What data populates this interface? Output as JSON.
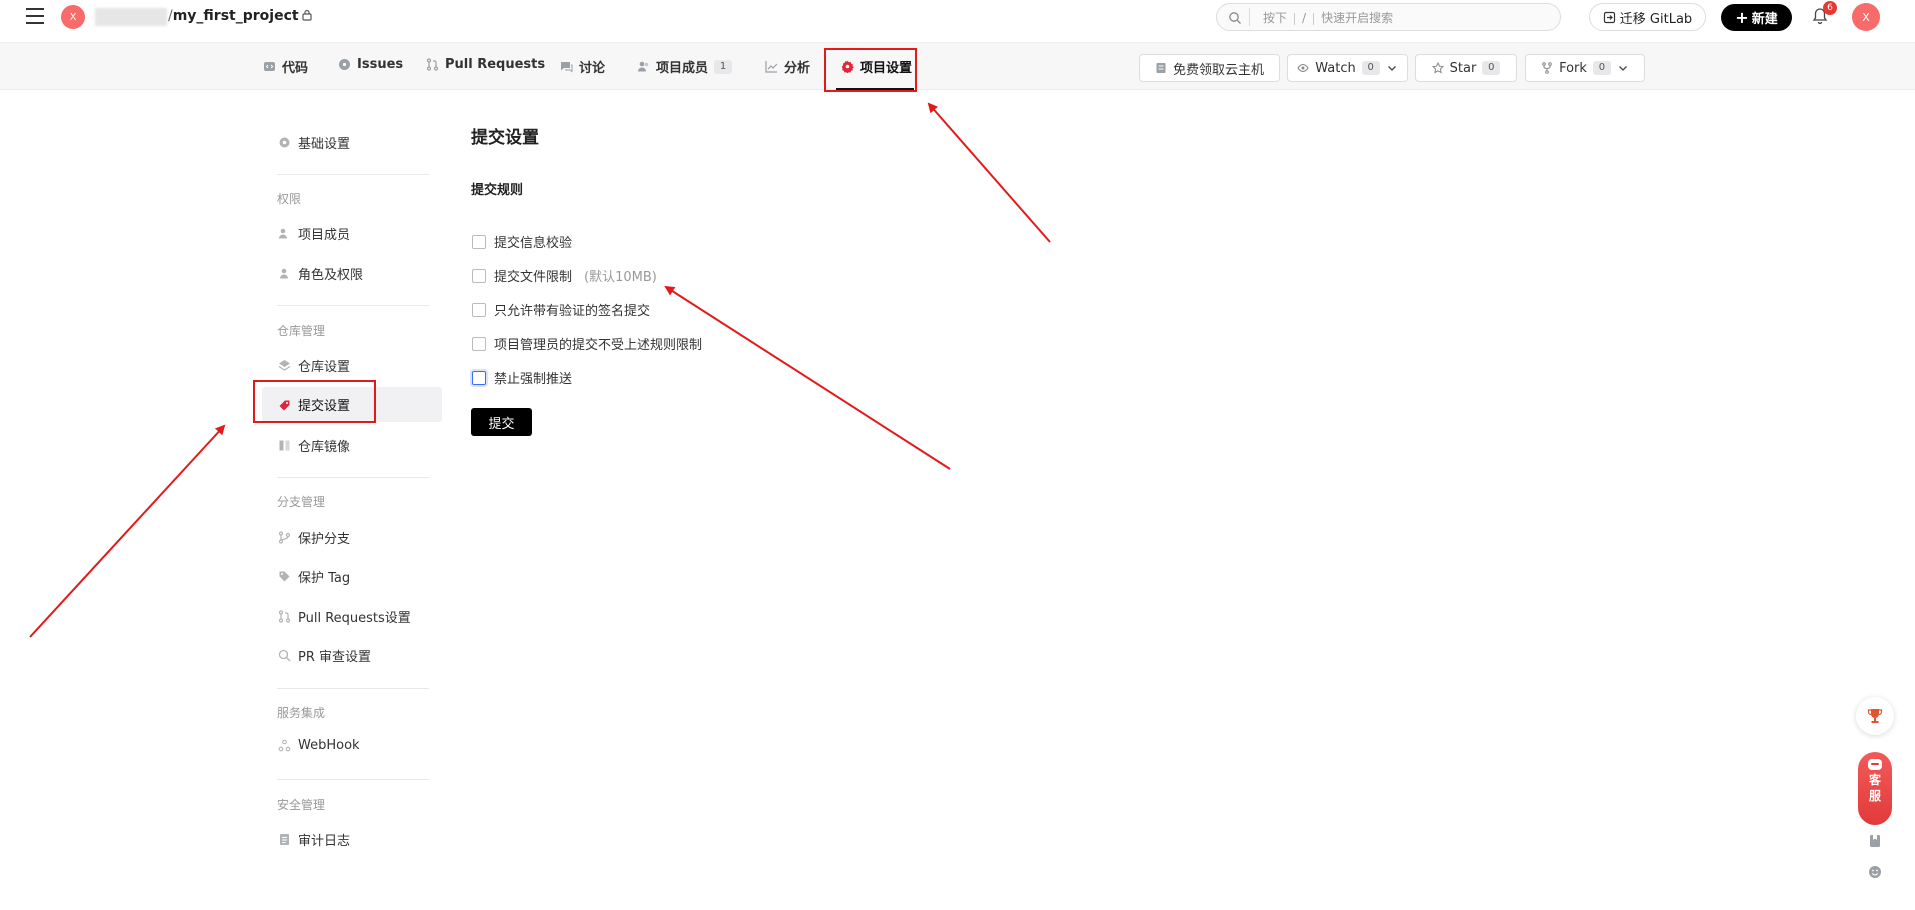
{
  "header": {
    "menu_icon": "hamburger-icon",
    "avatar_letter": "X",
    "repo_separator": "/",
    "repo_name": "my_first_project",
    "lock_icon": "lock-icon",
    "search": {
      "placeholder": "按下 / 快速开启搜索",
      "key_hint_prefix": "按下",
      "key": "/",
      "key_hint_suffix": "快速开启搜索"
    },
    "migrate_label": "迁移 GitLab",
    "new_label": "新建",
    "notification_count": "6",
    "user_avatar_letter": "X"
  },
  "nav": {
    "tabs": [
      {
        "label": "代码",
        "icon": "code-icon"
      },
      {
        "label": "Issues",
        "icon": "issues-icon"
      },
      {
        "label": "Pull Requests",
        "icon": "pull-request-icon"
      },
      {
        "label": "讨论",
        "icon": "discussion-icon"
      },
      {
        "label": "项目成员",
        "icon": "members-icon",
        "count": "1"
      },
      {
        "label": "分析",
        "icon": "analysis-icon"
      },
      {
        "label": "项目设置",
        "icon": "settings-icon",
        "active": true
      }
    ],
    "right": {
      "cloud_label": "免费领取云主机",
      "watch_label": "Watch",
      "watch_count": "0",
      "star_label": "Star",
      "star_count": "0",
      "fork_label": "Fork",
      "fork_count": "0"
    }
  },
  "sidebar": {
    "basic": "基础设置",
    "groups": [
      {
        "title": "权限",
        "items": [
          "项目成员",
          "角色及权限"
        ]
      },
      {
        "title": "仓库管理",
        "items": [
          "仓库设置",
          "提交设置",
          "仓库镜像"
        ]
      },
      {
        "title": "分支管理",
        "items": [
          "保护分支",
          "保护 Tag",
          "Pull Requests设置",
          "PR 审查设置"
        ]
      },
      {
        "title": "服务集成",
        "items": [
          "WebHook"
        ]
      },
      {
        "title": "安全管理",
        "items": [
          "审计日志"
        ]
      }
    ],
    "active_item": "提交设置"
  },
  "main": {
    "title": "提交设置",
    "section": "提交规则",
    "rules": [
      {
        "label": "提交信息校验",
        "checked": false
      },
      {
        "label": "提交文件限制",
        "hint": "(默认10MB)",
        "checked": false
      },
      {
        "label": "只允许带有验证的签名提交",
        "checked": false
      },
      {
        "label": "项目管理员的提交不受上述规则限制",
        "checked": false
      },
      {
        "label": "禁止强制推送",
        "checked": false,
        "focused": true
      }
    ],
    "submit_label": "提交"
  },
  "float": {
    "service_chars": [
      "客",
      "服"
    ]
  },
  "colors": {
    "annotation_red": "#e21a1a",
    "avatar_red": "#f76b6b",
    "primary_black": "#000000",
    "badge_red": "#e53935",
    "focus_blue": "#3a6cf4"
  }
}
